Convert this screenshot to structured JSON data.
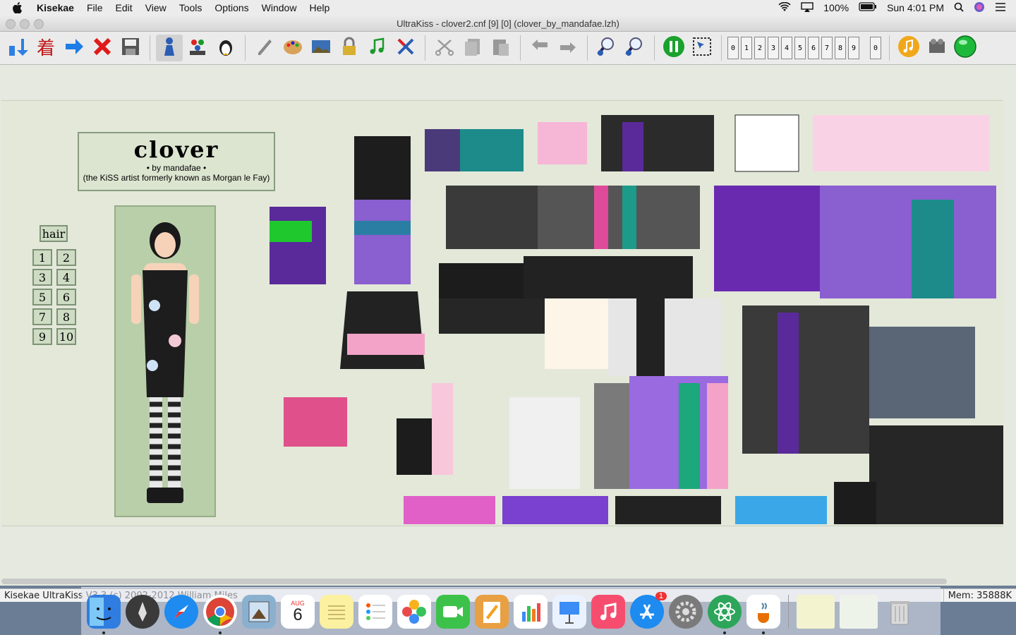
{
  "menubar": {
    "app_name": "Kisekae",
    "items": [
      "File",
      "Edit",
      "View",
      "Tools",
      "Options",
      "Window",
      "Help"
    ],
    "battery": "100%",
    "clock": "Sun 4:01 PM"
  },
  "window": {
    "title": "UltraKiss -  clover2.cnf [9] [0]  (clover_by_mandafae.lzh)"
  },
  "toolbar": {
    "icons": [
      "open-icon",
      "kanji-icon",
      "next-arrow-icon",
      "close-x-icon",
      "save-icon",
      "doll-icon",
      "cast-icon",
      "penguin-icon",
      "pencil-icon",
      "palette-icon",
      "image-icon",
      "lock-icon",
      "music-icon",
      "tools-icon",
      "scissors-icon",
      "copy-icon",
      "paste-icon",
      "undo-icon",
      "redo-icon",
      "zoom-in-icon",
      "zoom-out-icon",
      "pause-icon",
      "select-icon"
    ],
    "page_digits": [
      "0",
      "1",
      "2",
      "3",
      "4",
      "5",
      "6",
      "7",
      "8",
      "9"
    ],
    "color_set": "0"
  },
  "doll": {
    "title": "clover",
    "byline": "• by mandafae •",
    "subtitle": "(the KiSS artist formerly known as Morgan le Fay)",
    "hair_label": "hair",
    "hair_buttons": [
      "1",
      "2",
      "3",
      "4",
      "5",
      "6",
      "7",
      "8",
      "9",
      "10"
    ]
  },
  "status": {
    "left": "Kisekae UltraKiss V3.3 (c) 2002-2012 William Miles",
    "right": "Mem: 35888K"
  },
  "dock": {
    "calendar_month": "AUG",
    "calendar_day": "6",
    "appstore_badge": "1"
  }
}
